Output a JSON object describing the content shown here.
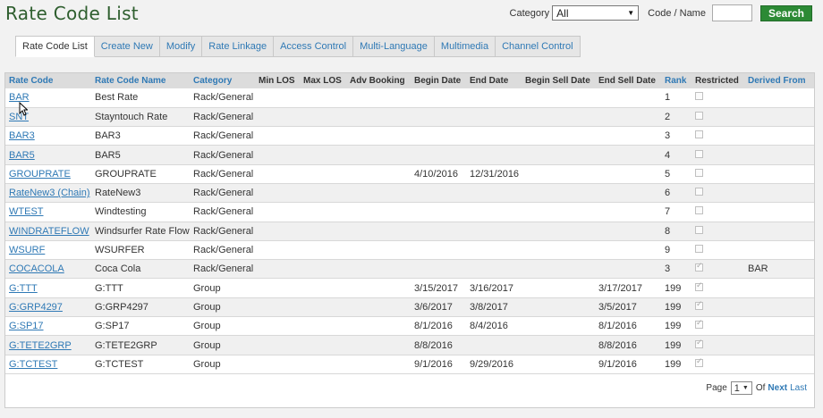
{
  "page": {
    "title": "Rate Code List"
  },
  "filters": {
    "category_label": "Category",
    "category_value": "All",
    "code_name_label": "Code / Name",
    "code_name_value": "",
    "search_label": "Search"
  },
  "tabs": [
    {
      "label": "Rate Code List",
      "active": true
    },
    {
      "label": "Create New"
    },
    {
      "label": "Modify"
    },
    {
      "label": "Rate Linkage"
    },
    {
      "label": "Access Control"
    },
    {
      "label": "Multi-Language"
    },
    {
      "label": "Multimedia"
    },
    {
      "label": "Channel Control"
    }
  ],
  "table": {
    "headers": [
      "Rate Code",
      "Rate Code Name",
      "Category",
      "Min LOS",
      "Max LOS",
      "Adv Booking",
      "Begin Date",
      "End Date",
      "Begin Sell Date",
      "End Sell Date",
      "Rank",
      "Restricted",
      "Derived From"
    ],
    "rows": [
      {
        "code": "BAR",
        "name": "Best Rate",
        "category": "Rack/General",
        "min_los": "",
        "max_los": "",
        "adv_booking": "",
        "begin_date": "",
        "end_date": "",
        "begin_sell": "",
        "end_sell": "",
        "rank": "1",
        "restricted": false,
        "derived_from": ""
      },
      {
        "code": "SNT",
        "name": "Stayntouch Rate",
        "category": "Rack/General",
        "min_los": "",
        "max_los": "",
        "adv_booking": "",
        "begin_date": "",
        "end_date": "",
        "begin_sell": "",
        "end_sell": "",
        "rank": "2",
        "restricted": false,
        "derived_from": ""
      },
      {
        "code": "BAR3",
        "name": "BAR3",
        "category": "Rack/General",
        "min_los": "",
        "max_los": "",
        "adv_booking": "",
        "begin_date": "",
        "end_date": "",
        "begin_sell": "",
        "end_sell": "",
        "rank": "3",
        "restricted": false,
        "derived_from": ""
      },
      {
        "code": "BAR5",
        "name": "BAR5",
        "category": "Rack/General",
        "min_los": "",
        "max_los": "",
        "adv_booking": "",
        "begin_date": "",
        "end_date": "",
        "begin_sell": "",
        "end_sell": "",
        "rank": "4",
        "restricted": false,
        "derived_from": ""
      },
      {
        "code": "GROUPRATE",
        "name": "GROUPRATE",
        "category": "Rack/General",
        "min_los": "",
        "max_los": "",
        "adv_booking": "",
        "begin_date": "4/10/2016",
        "end_date": "12/31/2016",
        "begin_sell": "",
        "end_sell": "",
        "rank": "5",
        "restricted": false,
        "derived_from": ""
      },
      {
        "code": "RateNew3 (Chain)",
        "name": "RateNew3",
        "category": "Rack/General",
        "min_los": "",
        "max_los": "",
        "adv_booking": "",
        "begin_date": "",
        "end_date": "",
        "begin_sell": "",
        "end_sell": "",
        "rank": "6",
        "restricted": false,
        "derived_from": ""
      },
      {
        "code": "WTEST",
        "name": "Windtesting",
        "category": "Rack/General",
        "min_los": "",
        "max_los": "",
        "adv_booking": "",
        "begin_date": "",
        "end_date": "",
        "begin_sell": "",
        "end_sell": "",
        "rank": "7",
        "restricted": false,
        "derived_from": ""
      },
      {
        "code": "WINDRATEFLOW",
        "name": "Windsurfer Rate Flow",
        "category": "Rack/General",
        "min_los": "",
        "max_los": "",
        "adv_booking": "",
        "begin_date": "",
        "end_date": "",
        "begin_sell": "",
        "end_sell": "",
        "rank": "8",
        "restricted": false,
        "derived_from": ""
      },
      {
        "code": "WSURF",
        "name": "WSURFER",
        "category": "Rack/General",
        "min_los": "",
        "max_los": "",
        "adv_booking": "",
        "begin_date": "",
        "end_date": "",
        "begin_sell": "",
        "end_sell": "",
        "rank": "9",
        "restricted": false,
        "derived_from": ""
      },
      {
        "code": "COCACOLA",
        "name": "Coca Cola",
        "category": "Rack/General",
        "min_los": "",
        "max_los": "",
        "adv_booking": "",
        "begin_date": "",
        "end_date": "",
        "begin_sell": "",
        "end_sell": "",
        "rank": "3",
        "restricted": true,
        "derived_from": "BAR"
      },
      {
        "code": "G:TTT",
        "name": "G:TTT",
        "category": "Group",
        "min_los": "",
        "max_los": "",
        "adv_booking": "",
        "begin_date": "3/15/2017",
        "end_date": "3/16/2017",
        "begin_sell": "",
        "end_sell": "3/17/2017",
        "rank": "199",
        "restricted": true,
        "derived_from": ""
      },
      {
        "code": "G:GRP4297",
        "name": "G:GRP4297",
        "category": "Group",
        "min_los": "",
        "max_los": "",
        "adv_booking": "",
        "begin_date": "3/6/2017",
        "end_date": "3/8/2017",
        "begin_sell": "",
        "end_sell": "3/5/2017",
        "rank": "199",
        "restricted": true,
        "derived_from": ""
      },
      {
        "code": "G:SP17",
        "name": "G:SP17",
        "category": "Group",
        "min_los": "",
        "max_los": "",
        "adv_booking": "",
        "begin_date": "8/1/2016",
        "end_date": "8/4/2016",
        "begin_sell": "",
        "end_sell": "8/1/2016",
        "rank": "199",
        "restricted": true,
        "derived_from": ""
      },
      {
        "code": "G:TETE2GRP",
        "name": "G:TETE2GRP",
        "category": "Group",
        "min_los": "",
        "max_los": "",
        "adv_booking": "",
        "begin_date": "8/8/2016",
        "end_date": "",
        "begin_sell": "",
        "end_sell": "8/8/2016",
        "rank": "199",
        "restricted": true,
        "derived_from": ""
      },
      {
        "code": "G:TCTEST",
        "name": "G:TCTEST",
        "category": "Group",
        "min_los": "",
        "max_los": "",
        "adv_booking": "",
        "begin_date": "9/1/2016",
        "end_date": "9/29/2016",
        "begin_sell": "",
        "end_sell": "9/1/2016",
        "rank": "199",
        "restricted": true,
        "derived_from": ""
      }
    ]
  },
  "pagination": {
    "page_label": "Page",
    "page_value": "1",
    "of_label": "Of",
    "next_label": "Next",
    "last_label": "Last"
  },
  "colors": {
    "title": "#2e5e2e",
    "link": "#2f79b5",
    "search_button": "#2c8a35"
  }
}
